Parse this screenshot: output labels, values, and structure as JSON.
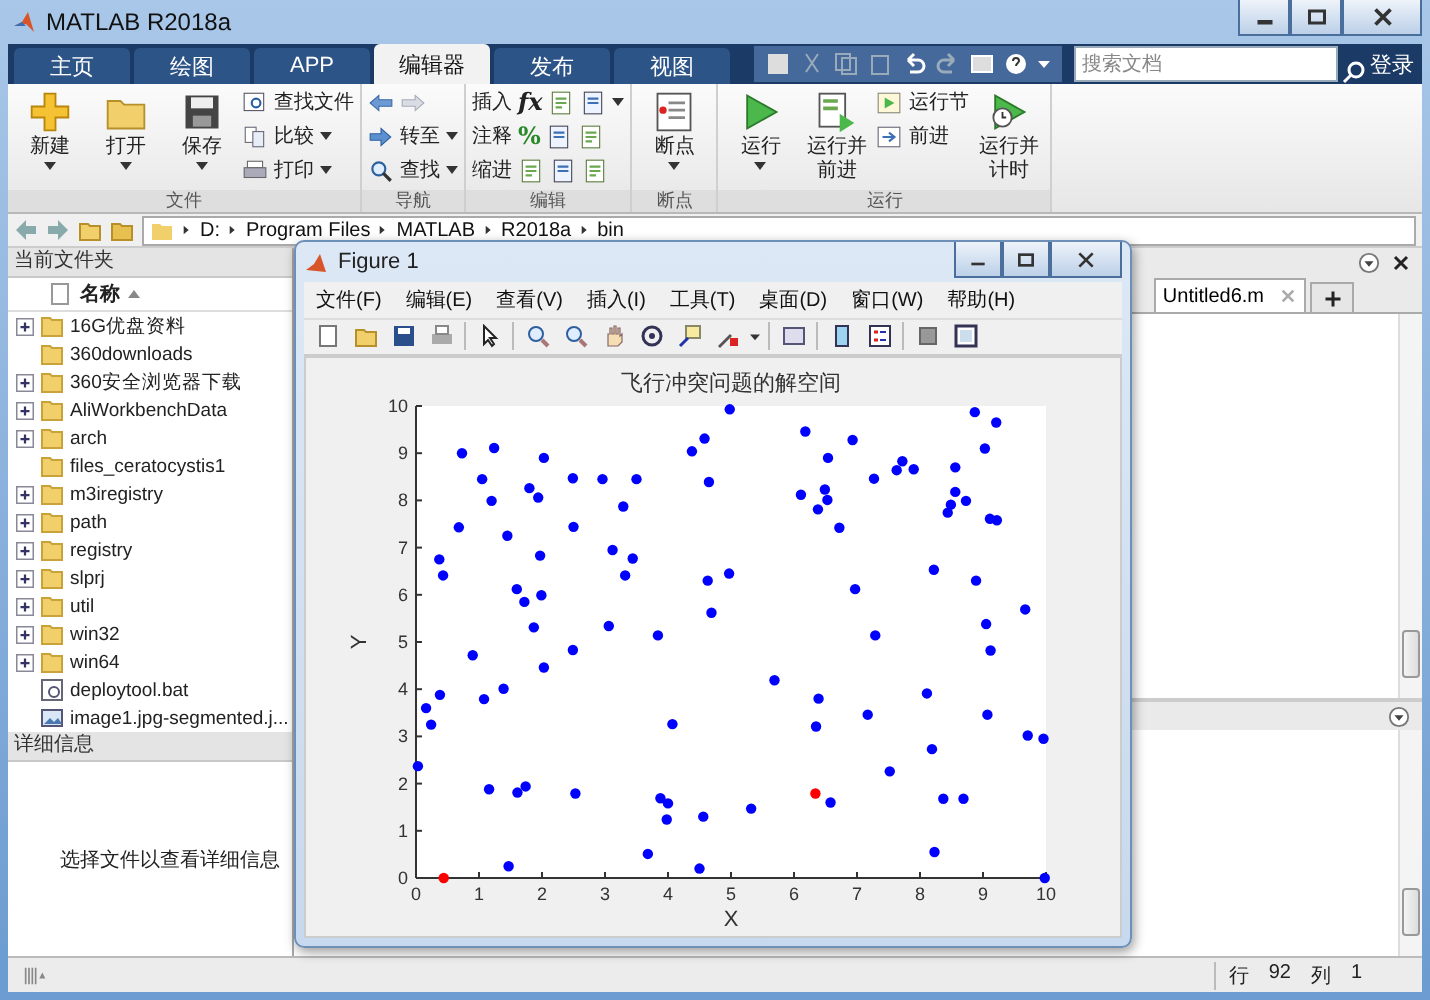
{
  "window": {
    "title": "MATLAB R2018a"
  },
  "tabs": [
    {
      "label": "主页",
      "selected": false
    },
    {
      "label": "绘图",
      "selected": false
    },
    {
      "label": "APP",
      "selected": false
    },
    {
      "label": "编辑器",
      "selected": true
    },
    {
      "label": "发布",
      "selected": false
    },
    {
      "label": "视图",
      "selected": false
    }
  ],
  "search": {
    "placeholder": "搜索文档"
  },
  "sign_in": "登录",
  "ribbon": [
    {
      "label": "文件",
      "items": [
        {
          "kind": "big",
          "label": "新建",
          "caret": true
        },
        {
          "kind": "big",
          "label": "打开",
          "caret": true
        },
        {
          "kind": "big",
          "label": "保存",
          "caret": true
        },
        {
          "kind": "stack",
          "rows": [
            {
              "label": "查找文件",
              "caret": false
            },
            {
              "label": "比较",
              "caret": true
            },
            {
              "label": "打印",
              "caret": true
            }
          ]
        }
      ]
    },
    {
      "label": "导航",
      "items": [
        {
          "kind": "stack",
          "rows": [
            {
              "caret": false
            },
            {
              "label": "转至",
              "caret": true
            },
            {
              "label": "查找",
              "caret": true
            }
          ]
        }
      ]
    },
    {
      "label": "编辑",
      "items": [
        {
          "kind": "stack",
          "rows": [
            {
              "label": "插入",
              "glyph": "fx",
              "caret": true
            },
            {
              "label": "注释",
              "glyph": "%",
              "caret": false
            },
            {
              "label": "缩进",
              "caret": false
            }
          ]
        }
      ]
    },
    {
      "label": "断点",
      "items": [
        {
          "kind": "big",
          "label": "断点",
          "caret": true
        }
      ]
    },
    {
      "label": "运行",
      "items": [
        {
          "kind": "big",
          "label": "运行",
          "caret": true
        },
        {
          "kind": "big",
          "label": "运行并前进",
          "caret": false
        },
        {
          "kind": "stack",
          "rows": [
            {
              "label": "运行节",
              "caret": false
            },
            {
              "label": "前进",
              "caret": false
            }
          ]
        },
        {
          "kind": "big",
          "label": "运行并计时",
          "caret": false
        }
      ]
    }
  ],
  "address": [
    "D:",
    "Program Files",
    "MATLAB",
    "R2018a",
    "bin"
  ],
  "current_folder": {
    "title": "当前文件夹",
    "column": "名称",
    "items": [
      {
        "name": "16G优盘资料",
        "kind": "folder",
        "expandable": true
      },
      {
        "name": "360downloads",
        "kind": "folder",
        "expandable": false
      },
      {
        "name": "360安全浏览器下载",
        "kind": "folder",
        "expandable": true
      },
      {
        "name": "AliWorkbenchData",
        "kind": "folder",
        "expandable": true
      },
      {
        "name": "arch",
        "kind": "folder",
        "expandable": true
      },
      {
        "name": "files_ceratocystis1",
        "kind": "folder",
        "expandable": false
      },
      {
        "name": "m3iregistry",
        "kind": "folder",
        "expandable": true
      },
      {
        "name": "path",
        "kind": "folder",
        "expandable": true
      },
      {
        "name": "registry",
        "kind": "folder",
        "expandable": true
      },
      {
        "name": "slprj",
        "kind": "folder",
        "expandable": true
      },
      {
        "name": "util",
        "kind": "folder",
        "expandable": true
      },
      {
        "name": "win32",
        "kind": "folder",
        "expandable": true
      },
      {
        "name": "win64",
        "kind": "folder",
        "expandable": true
      },
      {
        "name": "deploytool.bat",
        "kind": "script",
        "expandable": false
      },
      {
        "name": "image1.jpg-segmented.j...",
        "kind": "image",
        "expandable": false
      }
    ]
  },
  "details": {
    "title": "详细信息",
    "message": "选择文件以查看详细信息"
  },
  "editor": {
    "tabs": [
      {
        "label": "Untitled6.m",
        "selected": true
      }
    ]
  },
  "status_bar": {
    "row_label": "行",
    "row": "92",
    "col_label": "列",
    "col": "1"
  },
  "figure": {
    "title": "Figure 1",
    "menu": [
      "文件(F)",
      "编辑(E)",
      "查看(V)",
      "插入(I)",
      "工具(T)",
      "桌面(D)",
      "窗口(W)",
      "帮助(H)"
    ],
    "chart_data": {
      "type": "scatter",
      "title": "飞行冲突问题的解空间",
      "xlabel": "X",
      "ylabel": "Y",
      "xlim": [
        0,
        10
      ],
      "ylim": [
        0,
        10
      ],
      "xticks": [
        0,
        1,
        2,
        3,
        4,
        5,
        6,
        7,
        8,
        9,
        10
      ],
      "yticks": [
        0,
        1,
        2,
        3,
        4,
        5,
        6,
        7,
        8,
        9,
        10
      ],
      "series": [
        {
          "color": "#0000ff",
          "x": [
            0.03,
            0.16,
            0.24,
            0.38,
            0.37,
            0.43,
            0.73,
            0.68,
            0.9,
            1.05,
            1.08,
            1.16,
            1.2,
            1.24,
            1.39,
            1.45,
            1.47,
            1.6,
            1.61,
            1.72,
            1.74,
            1.8,
            1.87,
            1.94,
            1.97,
            1.99,
            2.03,
            2.03,
            2.49,
            2.49,
            2.5,
            2.53,
            2.96,
            3.06,
            3.12,
            3.29,
            3.32,
            3.44,
            3.5,
            3.68,
            3.84,
            3.88,
            3.98,
            4.0,
            4.07,
            4.38,
            4.5,
            4.56,
            4.58,
            4.63,
            4.65,
            4.69,
            4.98,
            4.97,
            5.32,
            5.69,
            6.11,
            6.18,
            6.35,
            6.38,
            6.39,
            6.49,
            6.53,
            6.54,
            6.58,
            6.72,
            6.93,
            6.97,
            7.17,
            7.27,
            7.29,
            7.52,
            7.63,
            7.72,
            7.9,
            8.11,
            8.19,
            8.22,
            8.23,
            8.37,
            8.44,
            8.49,
            8.56,
            8.56,
            8.69,
            8.73,
            8.87,
            8.89,
            9.03,
            9.05,
            9.07,
            9.11,
            9.12,
            9.22,
            9.21,
            9.67,
            9.71,
            9.96,
            9.98
          ],
          "values": [
            2.37,
            3.6,
            3.25,
            3.88,
            6.75,
            6.41,
            9.0,
            7.43,
            4.72,
            8.45,
            3.79,
            1.88,
            7.99,
            9.11,
            4.01,
            7.25,
            0.25,
            6.12,
            1.81,
            5.85,
            1.94,
            8.26,
            5.31,
            8.06,
            6.83,
            5.99,
            8.9,
            4.46,
            4.83,
            8.47,
            7.44,
            1.79,
            8.45,
            5.34,
            6.95,
            7.87,
            6.41,
            6.77,
            8.45,
            0.51,
            5.14,
            1.69,
            1.24,
            1.58,
            3.26,
            9.04,
            0.2,
            1.3,
            9.31,
            6.3,
            8.39,
            5.62,
            9.93,
            6.45,
            1.47,
            4.19,
            8.12,
            9.46,
            3.21,
            7.81,
            3.8,
            8.23,
            8.01,
            8.9,
            1.6,
            7.42,
            9.28,
            6.12,
            3.46,
            8.46,
            5.14,
            2.26,
            8.64,
            8.83,
            8.66,
            3.91,
            2.73,
            6.53,
            0.55,
            1.68,
            7.74,
            7.91,
            8.7,
            8.18,
            1.68,
            7.99,
            9.87,
            6.3,
            9.1,
            5.38,
            3.46,
            7.61,
            4.82,
            7.58,
            9.65,
            5.69,
            3.02,
            2.95,
            0.0
          ]
        },
        {
          "color": "#ff0000",
          "x": [
            0.44,
            6.34
          ],
          "values": [
            0.0,
            1.79
          ]
        }
      ]
    }
  }
}
